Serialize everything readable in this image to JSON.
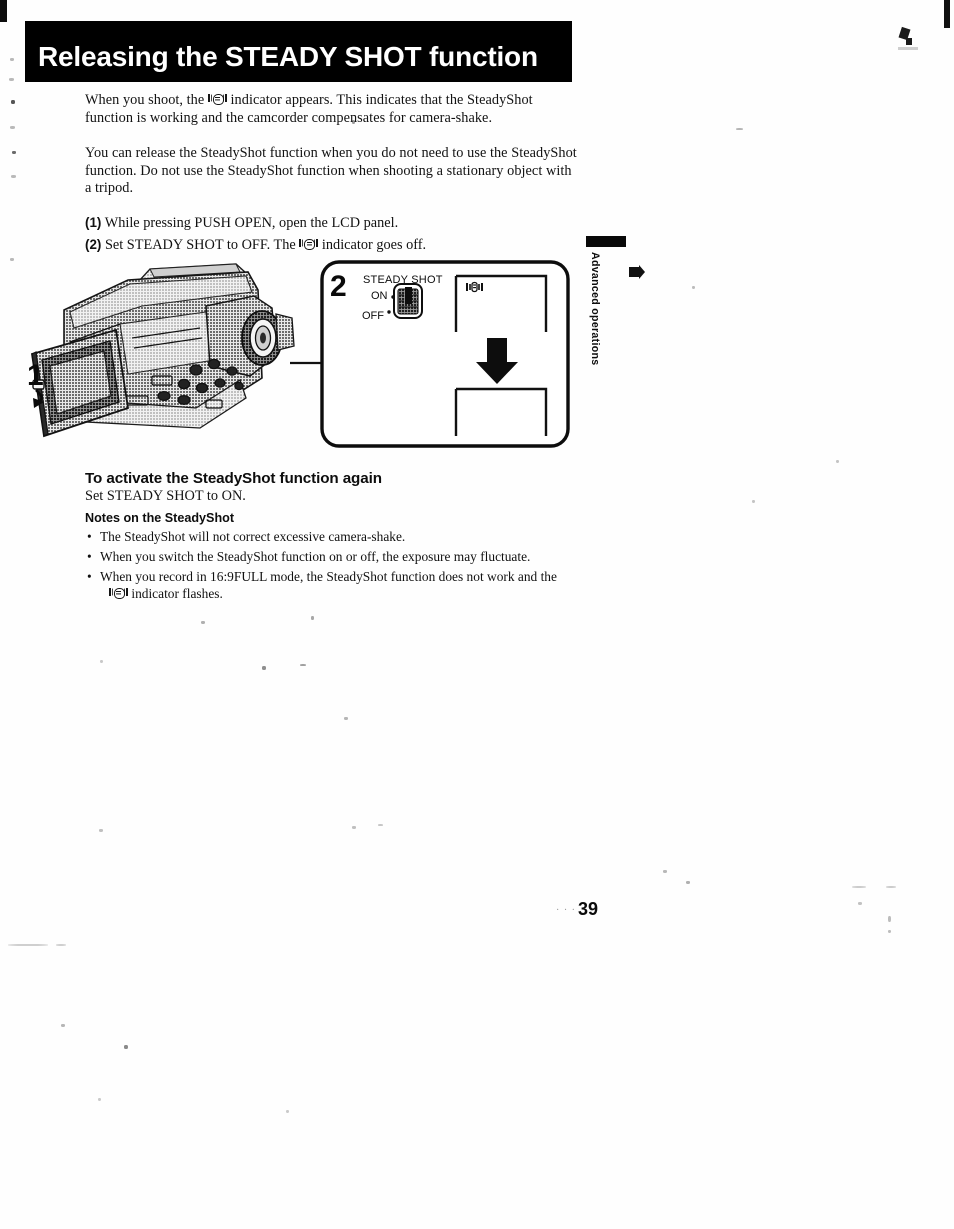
{
  "document": {
    "type": "scanned-manual-page",
    "page_number": "39",
    "side_tab_label": "Advanced operations"
  },
  "header": {
    "title": "Releasing the STEADY SHOT function",
    "background_color": "#000000",
    "text_color": "#ffffff"
  },
  "body": {
    "paragraph_1_before_icon": "When you shoot, the ",
    "paragraph_1_after_icon": " indicator appears. This indicates that the SteadyShot function is working and the camcorder compensates for camera-shake.",
    "paragraph_2": "You can release the SteadyShot function when you do not need to use the SteadyShot function. Do not use the SteadyShot function when shooting a stationary object with a tripod."
  },
  "steps": [
    {
      "number": "(1)",
      "text": "While pressing PUSH OPEN, open the LCD panel.",
      "text_after_icon": ""
    },
    {
      "number": "(2)",
      "text": "Set STEADY SHOT to OFF. The ",
      "text_after_icon": " indicator goes off."
    }
  ],
  "illustration": {
    "callout_1": "1",
    "callout_2": "2",
    "switch_label": "STEADY SHOT",
    "switch_position_on": "ON",
    "switch_position_off": "OFF",
    "switch_selected": "OFF",
    "viewfinder_top_icon": "steadyshot-hand-icon",
    "viewfinder_bottom_icon": "",
    "transition_arrow": "down-arrow",
    "device": "camcorder-with-open-lcd-panel"
  },
  "sections": {
    "reactivate_heading": "To activate the SteadyShot function again",
    "reactivate_body": "Set STEADY SHOT to ON.",
    "notes_heading": "Notes on the SteadyShot",
    "notes": [
      {
        "bullet": "•",
        "text": "The SteadyShot will not correct excessive camera-shake."
      },
      {
        "bullet": "•",
        "text": "When you switch the SteadyShot function on or off, the exposure may fluctuate."
      },
      {
        "bullet": "•",
        "text": "When you record in 16:9FULL mode, the SteadyShot function does not work and the",
        "text_continued": " indicator flashes."
      }
    ]
  },
  "colors": {
    "ink": "#111111",
    "banner": "#000000",
    "paper": "#fefefe"
  }
}
